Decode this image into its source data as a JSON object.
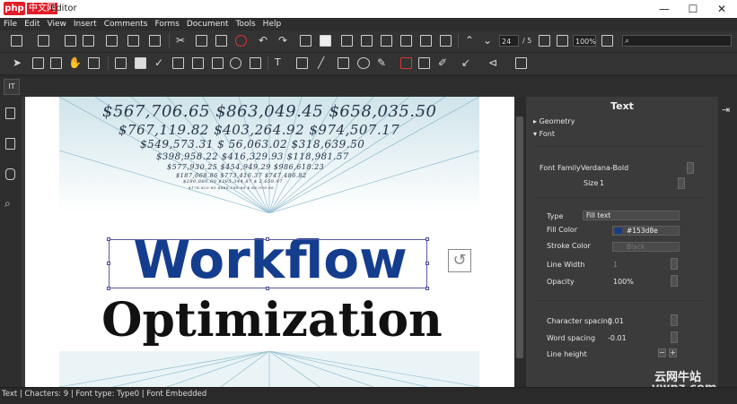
{
  "window": {
    "logo": "php",
    "logo_suffix": "中文网",
    "title": "Editor",
    "minimize": "—",
    "maximize": "☐",
    "close": "✕"
  },
  "menu": [
    "File",
    "Edit",
    "View",
    "Insert",
    "Comments",
    "Forms",
    "Document",
    "Tools",
    "Help"
  ],
  "toolbar": {
    "page_number": "24",
    "page_total": "/ 5",
    "zoom": "100%",
    "search_icon": "⌕"
  },
  "tab": {
    "label": "IT"
  },
  "document": {
    "headline": "Workflow",
    "subheadline": "Optimization",
    "number_rows": [
      "$567,706.65  $863,049.45  $658,035.50",
      "$767,119.82  $403,264.92  $974,507.17",
      "$549,573.31  $ 56,063.02  $318,639.50",
      "$398,958.22  $416,329.93  $118,981.57",
      "$577,930.25  $454,949.29  $986,618.23",
      "$187,668.86  $773,416.37  $747,486.82",
      "$280,860.60  $385,344.87  $ 2,659.97",
      "$178,820.80  $488,188.88  $ 88,999.66"
    ]
  },
  "panel": {
    "title": "Text",
    "section_geometry": "Geometry",
    "section_font": "Font",
    "font_family_label": "Font Family",
    "font_family_value": "Verdana-Bold",
    "size_label": "Size",
    "size_value": "1",
    "type_label": "Type",
    "type_value": "Fill text",
    "fill_color_label": "Fill Color",
    "fill_color_value": "#153d8e",
    "fill_color_hex": "#153d8e",
    "stroke_color_label": "Stroke Color",
    "stroke_color_value": "Black",
    "line_width_label": "Line Width",
    "line_width_value": "1",
    "opacity_label": "Opacity",
    "opacity_value": "100%",
    "char_spacing_label": "Character spacing",
    "char_spacing_value": "0.01",
    "word_spacing_label": "Word spacing",
    "word_spacing_value": "-0.01",
    "line_height_label": "Line height",
    "line_height_minus": "−",
    "line_height_plus": "+"
  },
  "status": {
    "text": "Text | Chacters: 9 | Font type: Type0 | Font Embedded"
  },
  "watermark": {
    "line1": "云网牛站",
    "line2": "ywnz.com"
  },
  "colors": {
    "headline": "#153d8e",
    "logo": "#e11d27"
  }
}
